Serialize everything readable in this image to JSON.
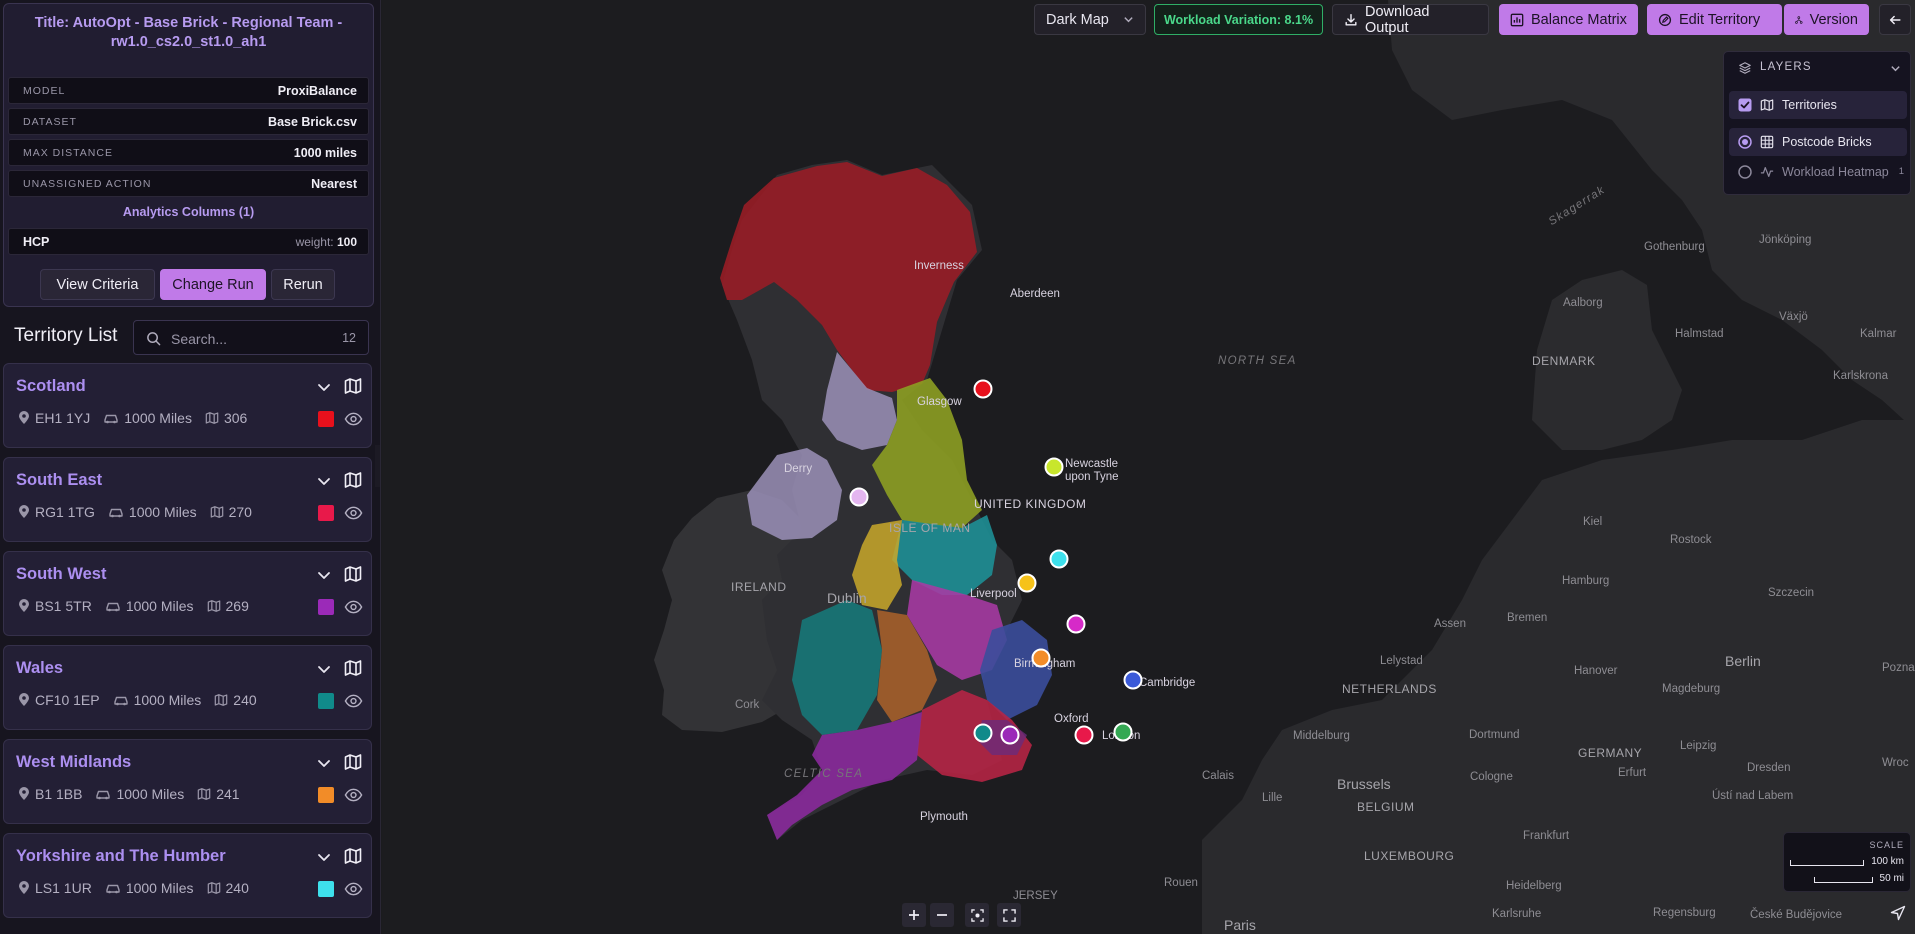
{
  "run": {
    "title": "Title: AutoOpt - Base Brick - Regional Team - rw1.0_cs2.0_st1.0_ah1",
    "meta": [
      {
        "key": "MODEL",
        "value": "ProxiBalance"
      },
      {
        "key": "DATASET",
        "value": "Base Brick.csv"
      },
      {
        "key": "MAX DISTANCE",
        "value": "1000 miles"
      },
      {
        "key": "UNASSIGNED ACTION",
        "value": "Nearest"
      }
    ],
    "analytics_title": "Analytics Columns (1)",
    "analytics": [
      {
        "name": "HCP",
        "weight_label": "weight:",
        "weight": "100"
      }
    ],
    "buttons": {
      "view_criteria": "View Criteria",
      "change_run": "Change Run",
      "rerun": "Rerun"
    }
  },
  "territory_list": {
    "title": "Territory List",
    "search_placeholder": "Search...",
    "count": "12",
    "items": [
      {
        "name": "Scotland",
        "postcode": "EH1 1YJ",
        "distance": "1000 Miles",
        "bricks": "306",
        "color": "#e8101c"
      },
      {
        "name": "South East",
        "postcode": "RG1 1TG",
        "distance": "1000 Miles",
        "bricks": "270",
        "color": "#e8194a"
      },
      {
        "name": "South West",
        "postcode": "BS1 5TR",
        "distance": "1000 Miles",
        "bricks": "269",
        "color": "#9b2ab8"
      },
      {
        "name": "Wales",
        "postcode": "CF10 1EP",
        "distance": "1000 Miles",
        "bricks": "240",
        "color": "#108a8a"
      },
      {
        "name": "West Midlands",
        "postcode": "B1 1BB",
        "distance": "1000 Miles",
        "bricks": "241",
        "color": "#f28c28"
      },
      {
        "name": "Yorkshire and The Humber",
        "postcode": "LS1 1UR",
        "distance": "1000 Miles",
        "bricks": "240",
        "color": "#3ee0ec"
      }
    ]
  },
  "toolbar": {
    "basemap": "Dark Map",
    "workload_variation": "Workload Variation: 8.1%",
    "download": "Download Output",
    "balance_matrix": "Balance Matrix",
    "edit_territory": "Edit Territory",
    "version": "Version"
  },
  "layers": {
    "title": "LAYERS",
    "items": [
      {
        "label": "Territories",
        "checked": true
      },
      {
        "label": "Postcode Bricks",
        "selected": true
      },
      {
        "label": "Workload Heatmap",
        "selected": false,
        "badge": "1"
      }
    ]
  },
  "scale": {
    "title": "SCALE",
    "km": "100 km",
    "mi": "50 mi"
  },
  "map_labels": {
    "north_sea": "NORTH SEA",
    "celtic_sea": "CELTIC SEA",
    "skagerrak": "Skagerrak",
    "isle_of_man": "ISLE OF MAN",
    "ireland": "IRELAND",
    "united_kingdom": "UNITED KINGDOM",
    "denmark": "DENMARK",
    "netherlands": "NETHERLANDS",
    "belgium": "BELGIUM",
    "germany": "GERMANY",
    "luxembourg": "LUXEMBOURG",
    "jersey": "JERSEY",
    "cities": {
      "inverness": "Inverness",
      "aberdeen": "Aberdeen",
      "glasgow": "Glasgow",
      "derry": "Derry",
      "newcastle": "Newcastle upon Tyne",
      "liverpool": "Liverpool",
      "birmingham": "Birmingham",
      "oxford": "Oxford",
      "london": "London",
      "cambridge": "Cambridge",
      "plymouth": "Plymouth",
      "dublin": "Dublin",
      "cork": "Cork",
      "calais": "Calais",
      "lille": "Lille",
      "brussels": "Brussels",
      "rouen": "Rouen",
      "paris": "Paris",
      "middelburg": "Middelburg",
      "lelystad": "Lelystad",
      "assen": "Assen",
      "bremen": "Bremen",
      "hamburg": "Hamburg",
      "kiel": "Kiel",
      "rostock": "Rostock",
      "szczecin": "Szczecin",
      "berlin": "Berlin",
      "hanover": "Hanover",
      "magdeburg": "Magdeburg",
      "dortmund": "Dortmund",
      "cologne": "Cologne",
      "erfurt": "Erfurt",
      "leipzig": "Leipzig",
      "dresden": "Dresden",
      "frankfurt": "Frankfurt",
      "usti": "Ústí nad Labem",
      "heidelberg": "Heidelberg",
      "karlsruhe": "Karlsruhe",
      "regensburg": "Regensburg",
      "budejovice": "České Budějovice",
      "aalborg": "Aalborg",
      "halmstad": "Halmstad",
      "vaxjo": "Växjö",
      "kalmar": "Kalmar",
      "karlskrona": "Karlskrona",
      "gothenburg": "Gothenburg",
      "jonkoping": "Jönköping",
      "poznan": "Pozna",
      "wroc": "Wroc"
    }
  }
}
